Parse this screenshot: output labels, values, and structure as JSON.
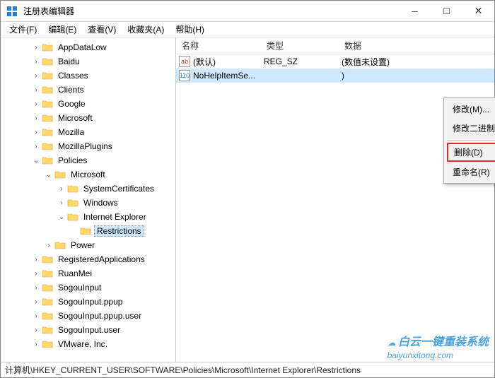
{
  "window": {
    "title": "注册表编辑器"
  },
  "menu": {
    "file": "文件(F)",
    "edit": "编辑(E)",
    "view": "查看(V)",
    "favorites": "收藏夹(A)",
    "help": "帮助(H)"
  },
  "tree": {
    "items": [
      {
        "indent": 2,
        "exp": ">",
        "label": "AppDataLow"
      },
      {
        "indent": 2,
        "exp": ">",
        "label": "Baidu"
      },
      {
        "indent": 2,
        "exp": ">",
        "label": "Classes"
      },
      {
        "indent": 2,
        "exp": ">",
        "label": "Clients"
      },
      {
        "indent": 2,
        "exp": ">",
        "label": "Google"
      },
      {
        "indent": 2,
        "exp": ">",
        "label": "Microsoft"
      },
      {
        "indent": 2,
        "exp": ">",
        "label": "Mozilla"
      },
      {
        "indent": 2,
        "exp": ">",
        "label": "MozillaPlugins"
      },
      {
        "indent": 2,
        "exp": "v",
        "label": "Policies"
      },
      {
        "indent": 3,
        "exp": "v",
        "label": "Microsoft"
      },
      {
        "indent": 4,
        "exp": ">",
        "label": "SystemCertificates"
      },
      {
        "indent": 4,
        "exp": ">",
        "label": "Windows"
      },
      {
        "indent": 4,
        "exp": "v",
        "label": "Internet Explorer"
      },
      {
        "indent": 5,
        "exp": "",
        "label": "Restrictions",
        "selected": true
      },
      {
        "indent": 3,
        "exp": ">",
        "label": "Power"
      },
      {
        "indent": 2,
        "exp": ">",
        "label": "RegisteredApplications"
      },
      {
        "indent": 2,
        "exp": ">",
        "label": "RuanMei"
      },
      {
        "indent": 2,
        "exp": ">",
        "label": "SogouInput"
      },
      {
        "indent": 2,
        "exp": ">",
        "label": "SogouInput.ppup"
      },
      {
        "indent": 2,
        "exp": ">",
        "label": "SogouInput.ppup.user"
      },
      {
        "indent": 2,
        "exp": ">",
        "label": "SogouInput.user"
      },
      {
        "indent": 2,
        "exp": ">",
        "label": "VMware, Inc."
      }
    ]
  },
  "list": {
    "columns": {
      "name": "名称",
      "type": "类型",
      "data": "数据"
    },
    "rows": [
      {
        "icon": "str",
        "name": "(默认)",
        "type": "REG_SZ",
        "data": "(数值未设置)",
        "selected": false
      },
      {
        "icon": "bin",
        "name": "NoHelpItemSe...",
        "type": "",
        "data": ")",
        "selected": true
      }
    ]
  },
  "context_menu": {
    "modify": "修改(M)...",
    "modify_binary": "修改二进制数据(B)...",
    "delete": "删除(D)",
    "rename": "重命名(R)"
  },
  "statusbar": {
    "path": "计算机\\HKEY_CURRENT_USER\\SOFTWARE\\Policies\\Microsoft\\Internet Explorer\\Restrictions"
  },
  "watermark": {
    "line1": "白云一键重装系统",
    "line2": "baiyunxitong.com"
  },
  "icon_labels": {
    "ab": "ab",
    "bin": "110"
  }
}
